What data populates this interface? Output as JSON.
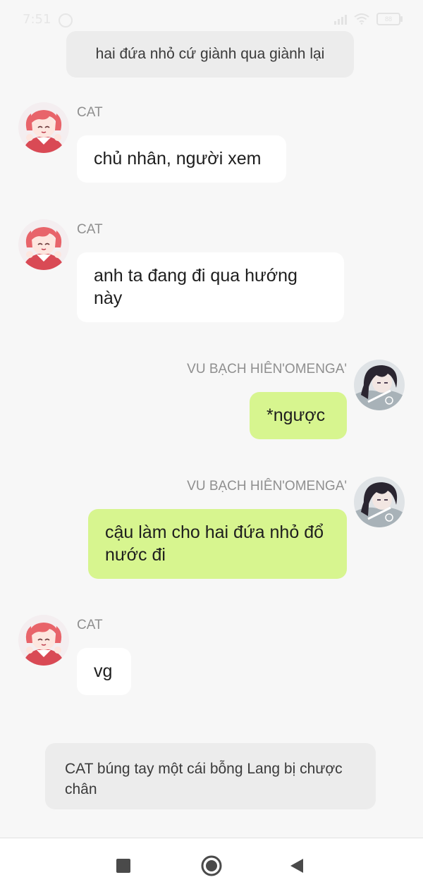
{
  "status_bar": {
    "time": "7:51",
    "battery": "88"
  },
  "narration": [
    {
      "text": "hai đứa nhỏ cứ giành qua giành lại"
    },
    {
      "text": "CAT búng tay một cái bỗng Lang bị chược chân"
    }
  ],
  "messages": [
    {
      "sender": "CAT",
      "text": "chủ nhân, người xem",
      "side": "left"
    },
    {
      "sender": "CAT",
      "text": "anh ta đang đi qua hướng này",
      "side": "left"
    },
    {
      "sender": "VU BẠCH HIÊN'OMENGA'",
      "text": "*ngược",
      "side": "right"
    },
    {
      "sender": "VU BẠCH HIÊN'OMENGA'",
      "text": "cậu làm cho hai đứa nhỏ đổ nước đi",
      "side": "right"
    },
    {
      "sender": "CAT",
      "text": "vg",
      "side": "left"
    }
  ],
  "avatars": {
    "cat": {
      "icon": "anime-girl-avatar-icon",
      "hair_color": "#e8646a",
      "shirt_color": "#d94a55"
    },
    "vu": {
      "icon": "anime-boy-avatar-icon",
      "hair_color": "#2a2530"
    }
  },
  "colors": {
    "background": "#f7f7f7",
    "bubble_left": "#ffffff",
    "bubble_right": "#d7f58f",
    "narration_bg": "#ececec",
    "sender_name": "#8f8f8f"
  },
  "nav": {
    "recents_icon": "square-icon",
    "home_icon": "circle-home-icon",
    "back_icon": "triangle-back-icon"
  }
}
